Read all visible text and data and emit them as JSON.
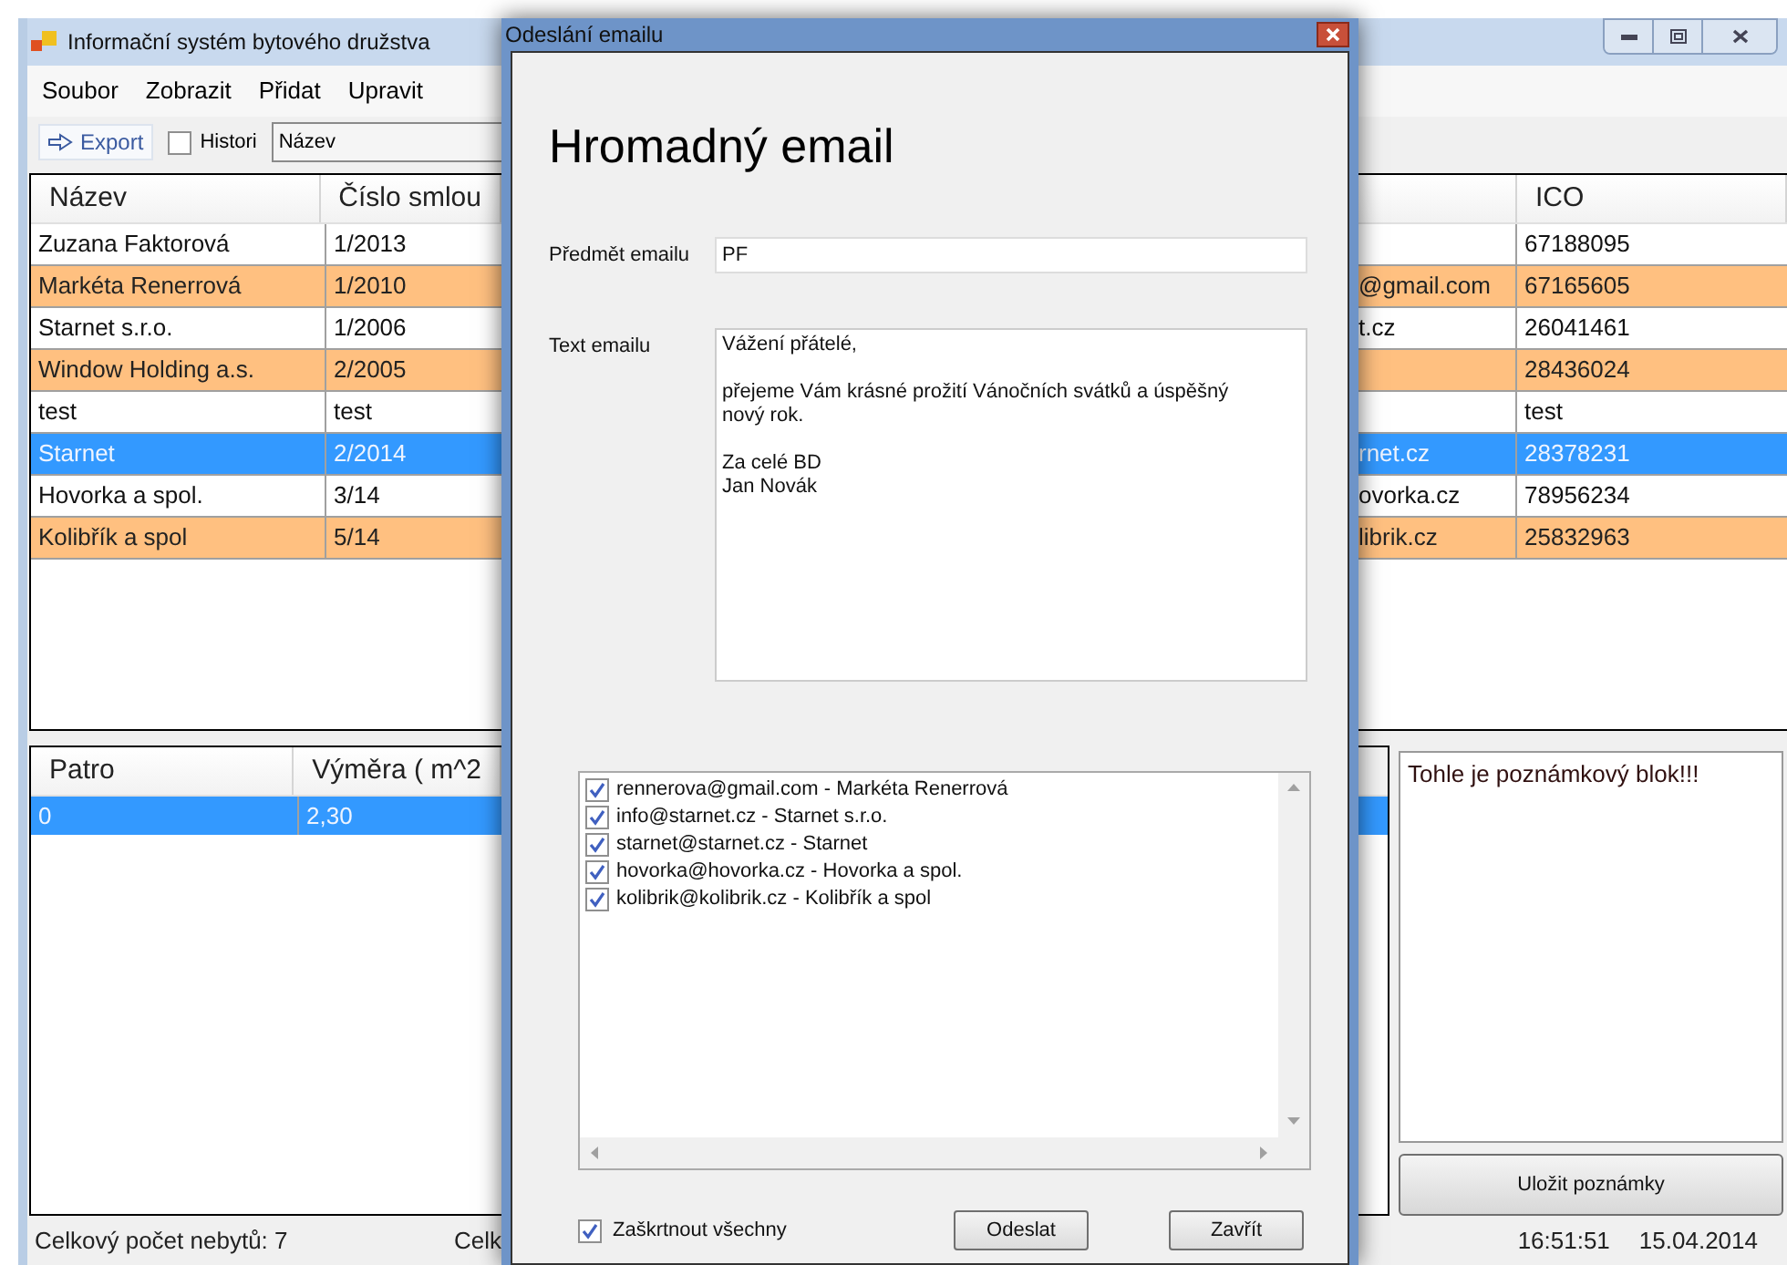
{
  "main_window": {
    "title": "Informační systém bytového družstva",
    "menu": [
      "Soubor",
      "Zobrazit",
      "Přidat",
      "Upravit"
    ],
    "toolbar": {
      "export_button": "Export",
      "history_checkbox": {
        "label": "Histori",
        "checked": false
      },
      "sort_select": "Název"
    },
    "top_table": {
      "columns_left": [
        "Název",
        "Číslo smlou"
      ],
      "columns_right": [
        "ICO"
      ],
      "rows": [
        {
          "name": "Zuzana Faktorová",
          "contract": "1/2013",
          "ico": "67188095",
          "highlighted": false,
          "selected": false
        },
        {
          "name": "Markéta Renerrová",
          "contract": "1/2010",
          "email_fragment": "@gmail.com",
          "ico": "67165605",
          "highlighted": true,
          "selected": false
        },
        {
          "name": "Starnet s.r.o.",
          "contract": "1/2006",
          "email_fragment": "t.cz",
          "ico": "26041461",
          "highlighted": false,
          "selected": false
        },
        {
          "name": "Window Holding a.s.",
          "contract": "2/2005",
          "ico": "28436024",
          "highlighted": true,
          "selected": false
        },
        {
          "name": "test",
          "contract": "test",
          "ico": "test",
          "highlighted": false,
          "selected": false
        },
        {
          "name": "Starnet",
          "contract": "2/2014",
          "email_fragment": "rnet.cz",
          "ico": "28378231",
          "selected": true
        },
        {
          "name": "Hovorka a spol.",
          "contract": "3/14",
          "email_fragment": "ovorka.cz",
          "ico": "78956234",
          "highlighted": false,
          "selected": false
        },
        {
          "name": "Kolibřík a spol",
          "contract": "5/14",
          "email_fragment": "librik.cz",
          "ico": "25832963",
          "highlighted": true,
          "selected": false
        }
      ]
    },
    "bottom_table": {
      "columns": [
        "Patro",
        "Výměra ( m^2"
      ],
      "rows": [
        {
          "floor": "0",
          "area": "2,30",
          "selected": true
        }
      ]
    },
    "notes": {
      "value": "Tohle je poznámkový blok!!!",
      "save_button": "Uložit poznámky"
    },
    "status_bar": {
      "count": "Celkový počet nebytů: 7",
      "fragment": "Celk",
      "time": "16:51:51",
      "date": "15.04.2014"
    }
  },
  "dialog": {
    "title": "Odeslání emailu",
    "heading": "Hromadný email",
    "subject": {
      "label": "Předmět emailu",
      "value": "PF"
    },
    "body": {
      "label": "Text emailu",
      "value": "Vážení přátelé,\n\npřejeme Vám krásné prožití Vánočních svátků a úspěšný nový rok.\n\nZa celé BD\nJan Novák"
    },
    "recipients": [
      {
        "label": "rennerova@gmail.com - Markéta Renerrová",
        "checked": true
      },
      {
        "label": "info@starnet.cz - Starnet s.r.o.",
        "checked": true
      },
      {
        "label": "starnet@starnet.cz - Starnet",
        "checked": true
      },
      {
        "label": "hovorka@hovorka.cz - Hovorka a spol.",
        "checked": true
      },
      {
        "label": "kolibrik@kolibrik.cz - Kolibřík a spol",
        "checked": true
      }
    ],
    "select_all": {
      "label": "Zaškrtnout všechny",
      "checked": true
    },
    "buttons": [
      "Odeslat",
      "Zavřít"
    ]
  }
}
